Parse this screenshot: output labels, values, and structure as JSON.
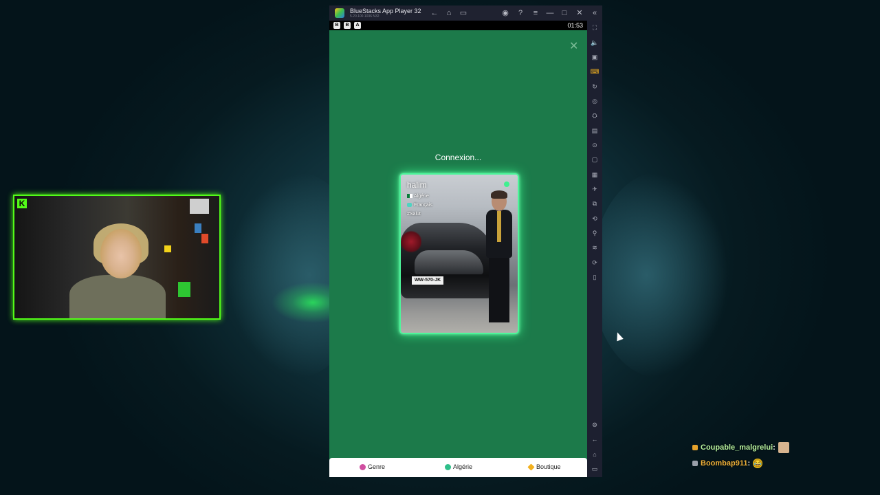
{
  "window": {
    "title": "BlueStacks App Player 32",
    "version": "5.20.100.1036 N32",
    "controls": {
      "back": "←",
      "home": "⌂",
      "recent": "▭",
      "account": "◉",
      "help": "?",
      "menu": "≡",
      "minimize": "—",
      "maximize": "□",
      "close": "✕",
      "collapse": "«"
    }
  },
  "status_bar": {
    "icons": [
      "B",
      "B",
      "A"
    ],
    "time": "01:53"
  },
  "app": {
    "close_label": "✕",
    "connecting_text": "Connexion...",
    "profile": {
      "name": "halim",
      "country": "Algérie",
      "language": "Français",
      "hashtag": "#Salut",
      "plate": "WW-570-JK"
    },
    "nav": [
      {
        "label": "Genre",
        "icon": "gender-icon",
        "color": "#d04fa0"
      },
      {
        "label": "Algérie",
        "icon": "globe-icon",
        "color": "#2fbf8a"
      },
      {
        "label": "Boutique",
        "icon": "diamond-icon",
        "color": "#f2b01e"
      }
    ]
  },
  "sidebar": {
    "items": [
      "⛶",
      "🔈",
      "▣",
      "⌨",
      "↻",
      "◎",
      "⛭",
      "▤",
      "⊙",
      "▢",
      "▦",
      "✈",
      "⧉",
      "⟲",
      "⚲",
      "≋",
      "⟳",
      "▯"
    ],
    "bottom": [
      "⚙",
      "←",
      "⌂",
      "▭"
    ]
  },
  "webcam": {
    "logo": "K"
  },
  "chat": [
    {
      "user": "Coupable_malgrelui",
      "separator": ":",
      "emote": "face-emote",
      "color": "#b9f5a0",
      "badge_color": "#e6a22b"
    },
    {
      "user": "Boombap911",
      "separator": ":",
      "emote": "laughing-emote",
      "color": "#f0b23a",
      "badge_color": "#9aa0aa",
      "emote_glyph": "😂"
    }
  ],
  "colors": {
    "kick_green": "#53fc18",
    "app_green": "#1c7a4a",
    "card_glow": "#38f08a"
  }
}
